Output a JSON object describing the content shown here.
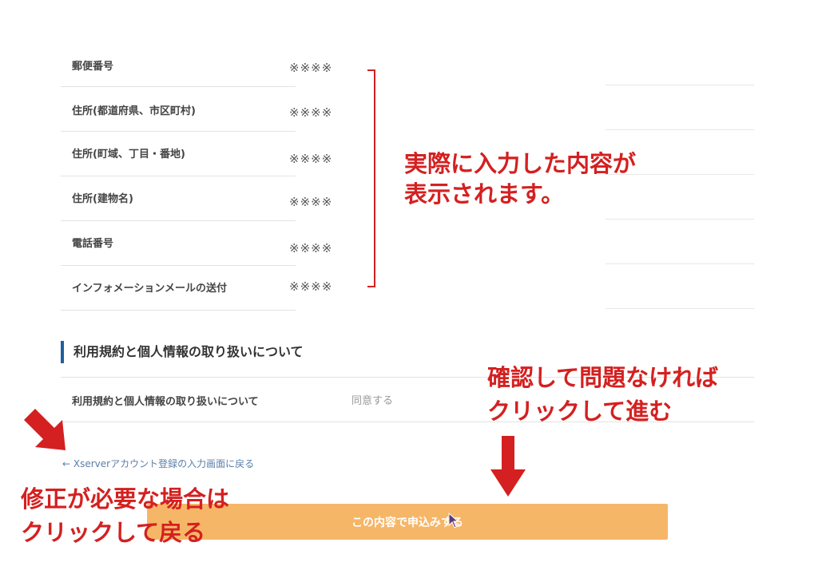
{
  "fields": [
    {
      "label": "郵便番号",
      "value": "※※※※"
    },
    {
      "label": "住所(都道府県、市区町村)",
      "value": "※※※※"
    },
    {
      "label": "住所(町域、丁目・番地)",
      "value": "※※※※"
    },
    {
      "label": "住所(建物名)",
      "value": "※※※※"
    },
    {
      "label": "電話番号",
      "value": "※※※※"
    },
    {
      "label": "インフォメーションメールの送付",
      "value": "※※※※"
    }
  ],
  "annotations": {
    "values_note": [
      "実際に入力した内容が",
      "表示されます。"
    ],
    "confirm_note": [
      "確認して問題なければ",
      "クリックして進む"
    ],
    "back_note": [
      "修正が必要な場合は",
      "クリックして戻る"
    ]
  },
  "terms_section": {
    "heading": "利用規約と個人情報の取り扱いについて",
    "row_label": "利用規約と個人情報の取り扱いについて",
    "row_value": "同意する"
  },
  "back_link": "← Xserverアカウント登録の入力画面に戻る",
  "submit_button": "この内容で申込みする",
  "colors": {
    "annotation_red": "#d42020",
    "button_orange": "#f6b668",
    "heading_accent": "#1f5fa0",
    "link_blue": "#5b7ea8"
  },
  "icons": [
    "arrow-down-right-icon",
    "arrow-down-icon",
    "mouse-cursor-icon"
  ]
}
